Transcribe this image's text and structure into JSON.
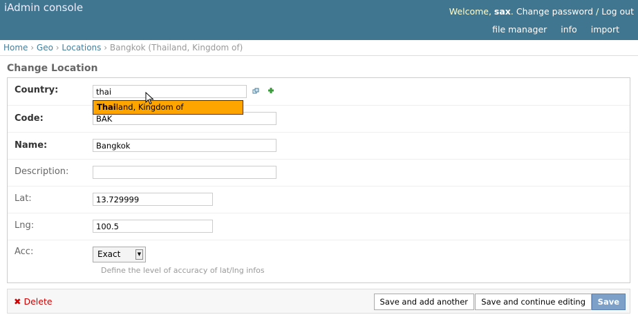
{
  "header": {
    "title": "iAdmin console",
    "welcome_prefix": "Welcome, ",
    "username": "sax",
    "welcome_suffix": ".",
    "change_password": "Change password",
    "separator": "/",
    "logout": "Log out",
    "tools": [
      "file manager",
      "info",
      "import"
    ]
  },
  "breadcrumbs": {
    "home": "Home",
    "sep": "›",
    "geo": "Geo",
    "locations": "Locations",
    "current": "Bangkok (Thailand, Kingdom of)"
  },
  "page": {
    "heading": "Change Location"
  },
  "form": {
    "country": {
      "label": "Country:",
      "value": "thai"
    },
    "autocomplete": {
      "match": "Thai",
      "rest": "land, Kingdom of"
    },
    "code": {
      "label": "Code:",
      "value": "BAK"
    },
    "name": {
      "label": "Name:",
      "value": "Bangkok"
    },
    "description": {
      "label": "Description:",
      "value": ""
    },
    "lat": {
      "label": "Lat:",
      "value": "13.729999"
    },
    "lng": {
      "label": "Lng:",
      "value": "100.5"
    },
    "acc": {
      "label": "Acc:",
      "value": "Exact",
      "help": "Define the level of accuracy of lat/lng infos"
    }
  },
  "actions": {
    "delete": "Delete",
    "save_add_another": "Save and add another",
    "save_continue": "Save and continue editing",
    "save": "Save"
  },
  "icons": {
    "lookup": "lookup-icon",
    "add": "add-icon",
    "delete": "delete-x-icon",
    "cursor": "mouse-cursor-icon"
  },
  "colors": {
    "header_bg": "#417690",
    "autocomplete_bg": "#ffa500",
    "save_bg": "#7ca0c7",
    "delete": "#cc0000"
  }
}
